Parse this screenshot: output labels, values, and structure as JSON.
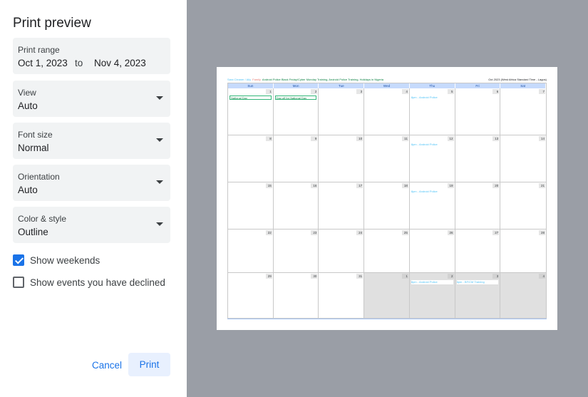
{
  "panel": {
    "title": "Print preview",
    "print_range": {
      "label": "Print range",
      "start": "Oct 1, 2023",
      "to": "to",
      "end": "Nov 4, 2023"
    },
    "view": {
      "label": "View",
      "value": "Auto"
    },
    "font_size": {
      "label": "Font size",
      "value": "Normal"
    },
    "orientation": {
      "label": "Orientation",
      "value": "Auto"
    },
    "color_style": {
      "label": "Color & style",
      "value": "Outline"
    },
    "show_weekends": {
      "label": "Show weekends",
      "checked": true
    },
    "show_declined": {
      "label": "Show events you have declined",
      "checked": false
    },
    "cancel_label": "Cancel",
    "print_label": "Print"
  },
  "preview": {
    "header_legend": [
      {
        "text": "Sara Cleaner / Ally",
        "color": "#4fc3f7"
      },
      {
        "text": "Family",
        "color": "#e67c73"
      },
      {
        "text": "Android Police Black Friday/Cyber Monday Training, Android Police Training, Holidays in Nigeria",
        "color": "#0b8043"
      }
    ],
    "timezone": "Oct 2023 (West Africa Standard Time - Lagos)",
    "weekdays": [
      "Sun",
      "Mon",
      "Tue",
      "Wed",
      "Thu",
      "Fri",
      "Sat"
    ],
    "weeks": [
      [
        {
          "d": "1",
          "out": false,
          "event": "National Day",
          "style": "box"
        },
        {
          "d": "2",
          "out": false,
          "event": "Day off for National Day",
          "style": "box"
        },
        {
          "d": "3",
          "out": false
        },
        {
          "d": "4",
          "out": false
        },
        {
          "d": "5",
          "out": false,
          "event": "8pm - Android Police",
          "style": "txt"
        },
        {
          "d": "6",
          "out": false
        },
        {
          "d": "7",
          "out": false
        }
      ],
      [
        {
          "d": "8",
          "out": false
        },
        {
          "d": "9",
          "out": false
        },
        {
          "d": "10",
          "out": false
        },
        {
          "d": "11",
          "out": false
        },
        {
          "d": "12",
          "out": false,
          "event": "8pm - Android Police",
          "style": "txt"
        },
        {
          "d": "13",
          "out": false
        },
        {
          "d": "14",
          "out": false
        }
      ],
      [
        {
          "d": "15",
          "out": false
        },
        {
          "d": "16",
          "out": false
        },
        {
          "d": "17",
          "out": false
        },
        {
          "d": "18",
          "out": false
        },
        {
          "d": "19",
          "out": false,
          "event": "8pm - Android Police",
          "style": "txt"
        },
        {
          "d": "20",
          "out": false
        },
        {
          "d": "21",
          "out": false
        }
      ],
      [
        {
          "d": "22",
          "out": false
        },
        {
          "d": "23",
          "out": false
        },
        {
          "d": "24",
          "out": false
        },
        {
          "d": "25",
          "out": false
        },
        {
          "d": "26",
          "out": false
        },
        {
          "d": "27",
          "out": false
        },
        {
          "d": "28",
          "out": false
        }
      ],
      [
        {
          "d": "29",
          "out": false
        },
        {
          "d": "30",
          "out": false
        },
        {
          "d": "31",
          "out": false
        },
        {
          "d": "1",
          "out": true
        },
        {
          "d": "2",
          "out": true,
          "event": "8pm - Android Police",
          "style": "txtbox"
        },
        {
          "d": "3",
          "out": true,
          "event": "6pm - BF/CM Training",
          "style": "txtbox"
        },
        {
          "d": "4",
          "out": true
        }
      ]
    ]
  }
}
